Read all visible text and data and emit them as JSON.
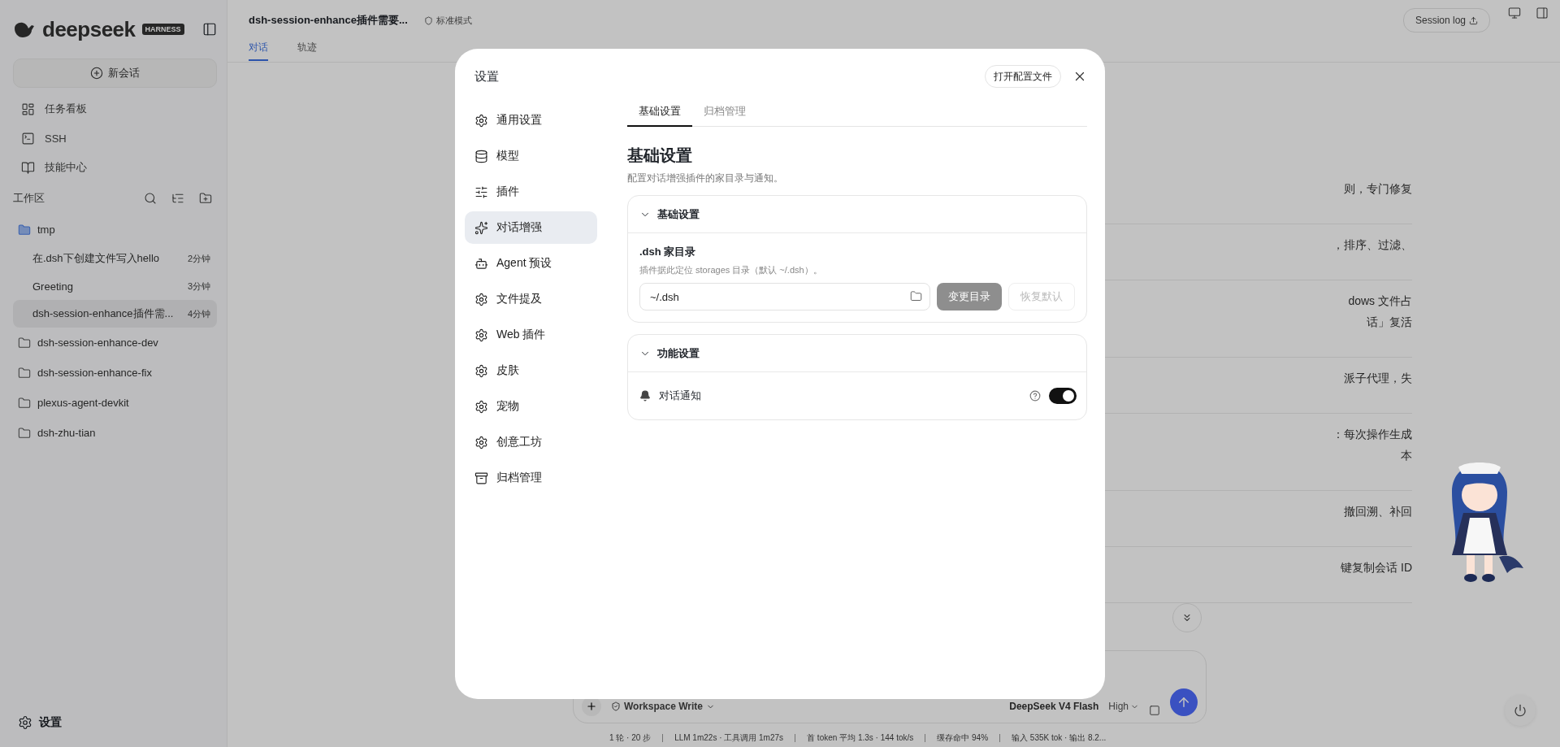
{
  "sidebar": {
    "logo": "deepseek",
    "badge": "HARNESS",
    "new_chat": "新会话",
    "nav": [
      {
        "label": "任务看板"
      },
      {
        "label": "SSH"
      },
      {
        "label": "技能中心"
      }
    ],
    "workspace_label": "工作区",
    "projects": [
      {
        "name": "tmp",
        "expanded": true,
        "children": [
          {
            "title": "在.dsh下创建文件写入hello",
            "time": "2分钟",
            "selected": false
          },
          {
            "title": "Greeting",
            "time": "3分钟",
            "selected": false
          },
          {
            "title": "dsh-session-enhance插件需...",
            "time": "4分钟",
            "selected": true
          }
        ]
      },
      {
        "name": "dsh-session-enhance-dev",
        "expanded": false
      },
      {
        "name": "dsh-session-enhance-fix",
        "expanded": false
      },
      {
        "name": "plexus-agent-devkit",
        "expanded": false
      },
      {
        "name": "dsh-zhu-tian",
        "expanded": false
      }
    ],
    "settings": "设置"
  },
  "header": {
    "title": "dsh-session-enhance插件需要...",
    "mode": "标准模式",
    "session_log": "Session log",
    "tabs": [
      {
        "label": "对话",
        "selected": true
      },
      {
        "label": "轨迹",
        "selected": false
      }
    ]
  },
  "messages": [
    {
      "lines": [
        "则，专门修复"
      ]
    },
    {
      "lines": [
        "，排序、过滤、"
      ]
    },
    {
      "lines": [
        "dows 文件占",
        "话」复活"
      ]
    },
    {
      "lines": [
        "派子代理，失"
      ]
    },
    {
      "lines": [
        "：每次操作生成",
        "本"
      ]
    },
    {
      "lines": [
        "撤回溯、补回"
      ]
    },
    {
      "lines": [
        "键复制会话 ID"
      ]
    }
  ],
  "composer": {
    "mode": "Workspace Write",
    "model": "DeepSeek V4 Flash",
    "effort": "High"
  },
  "status_bar": [
    "1 轮 · 20 步",
    "LLM 1m22s · 工具调用 1m27s",
    "首 token 平均 1.3s · 144 tok/s",
    "缓存命中 94%",
    "输入 535K tok · 输出 8.2..."
  ],
  "dialog": {
    "title": "设置",
    "open_config": "打开配置文件",
    "nav": [
      {
        "label": "通用设置",
        "selected": false
      },
      {
        "label": "模型",
        "selected": false
      },
      {
        "label": "插件",
        "selected": false
      },
      {
        "label": "对话增强",
        "selected": true
      },
      {
        "label": "Agent 预设",
        "selected": false
      },
      {
        "label": "文件提及",
        "selected": false
      },
      {
        "label": "Web 插件",
        "selected": false
      },
      {
        "label": "皮肤",
        "selected": false
      },
      {
        "label": "宠物",
        "selected": false
      },
      {
        "label": "创意工坊",
        "selected": false
      },
      {
        "label": "归档管理",
        "selected": false
      }
    ],
    "tabs": [
      {
        "label": "基础设置",
        "selected": true
      },
      {
        "label": "归档管理",
        "selected": false
      }
    ],
    "heading": "基础设置",
    "description": "配置对话增强插件的家目录与通知。",
    "sections": [
      {
        "title": "基础设置",
        "expanded": true,
        "kind": "directory",
        "field_label": ".dsh 家目录",
        "hint": "插件据此定位 storages 目录（默认 ~/.dsh）。",
        "value": "~/.dsh",
        "primary": "变更目录",
        "secondary": "恢复默认",
        "secondary_disabled": true
      },
      {
        "title": "功能设置",
        "expanded": true,
        "kind": "toggle",
        "label": "对话通知",
        "on": true
      }
    ]
  }
}
